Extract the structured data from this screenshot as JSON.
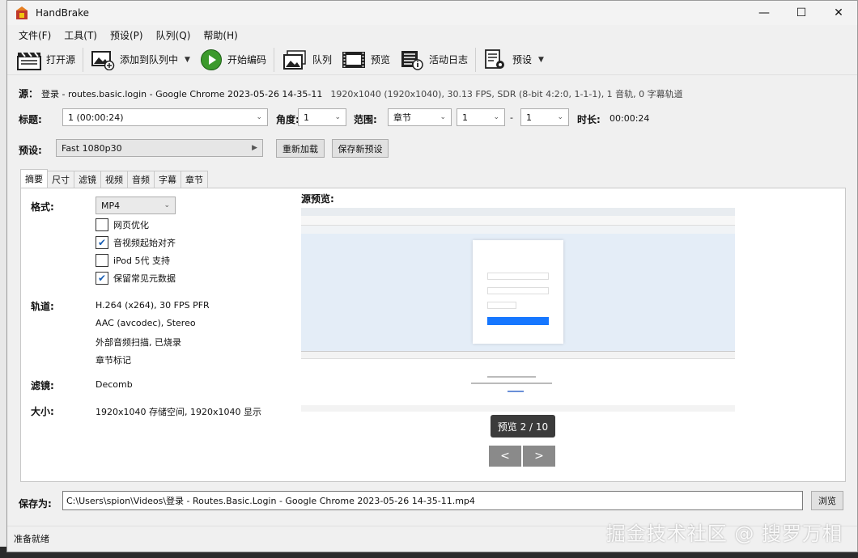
{
  "window": {
    "title": "HandBrake"
  },
  "menu": [
    "文件(F)",
    "工具(T)",
    "预设(P)",
    "队列(Q)",
    "帮助(H)"
  ],
  "toolbar": {
    "open_source": "打开源",
    "add_to_queue": "添加到队列中",
    "start_encode": "开始编码",
    "queue": "队列",
    "preview": "预览",
    "activity_log": "活动日志",
    "presets": "预设"
  },
  "source": {
    "label": "源：",
    "name": "登录 - routes.basic.login - Google Chrome 2023-05-26 14-35-11",
    "info": "1920x1040 (1920x1040), 30.13 FPS, SDR (8-bit 4:2:0, 1-1-1), 1 音轨, 0 字幕轨道"
  },
  "title_row": {
    "title_label": "标题:",
    "title_value": "1  (00:00:24)",
    "angle_label": "角度:",
    "angle_value": "1",
    "range_label": "范围:",
    "range_type": "章节",
    "range_start": "1",
    "range_dash": "-",
    "range_end": "1",
    "duration_label": "时长:",
    "duration_value": "00:00:24"
  },
  "preset_row": {
    "label": "预设:",
    "value": "Fast 1080p30",
    "reload": "重新加载",
    "save_new": "保存新预设"
  },
  "tabs": [
    "摘要",
    "尺寸",
    "滤镜",
    "视频",
    "音频",
    "字幕",
    "章节"
  ],
  "summary": {
    "format_label": "格式:",
    "format_value": "MP4",
    "checkboxes": [
      {
        "label": "网页优化",
        "checked": false
      },
      {
        "label": "音视频起始对齐",
        "checked": true
      },
      {
        "label": "iPod 5代 支持",
        "checked": false
      },
      {
        "label": "保留常见元数据",
        "checked": true
      }
    ],
    "tracks_label": "轨道:",
    "tracks": [
      "H.264 (x264), 30 FPS PFR",
      "AAC (avcodec), Stereo",
      "外部音频扫描, 已烧录",
      "章节标记"
    ],
    "filters_label": "滤镜:",
    "filters_value": "Decomb",
    "size_label": "大小:",
    "size_value": "1920x1040 存储空间, 1920x1040 显示",
    "preview_label": "源预览:",
    "preview_counter": "预览 2 / 10",
    "prev_btn": "<",
    "next_btn": ">"
  },
  "save": {
    "label": "保存为:",
    "path": "C:\\Users\\spion\\Videos\\登录 - Routes.Basic.Login - Google Chrome 2023-05-26 14-35-11.mp4",
    "browse": "浏览"
  },
  "status": {
    "text": "准备就绪"
  },
  "watermark": "掘金技术社区 @ 搜罗万相"
}
